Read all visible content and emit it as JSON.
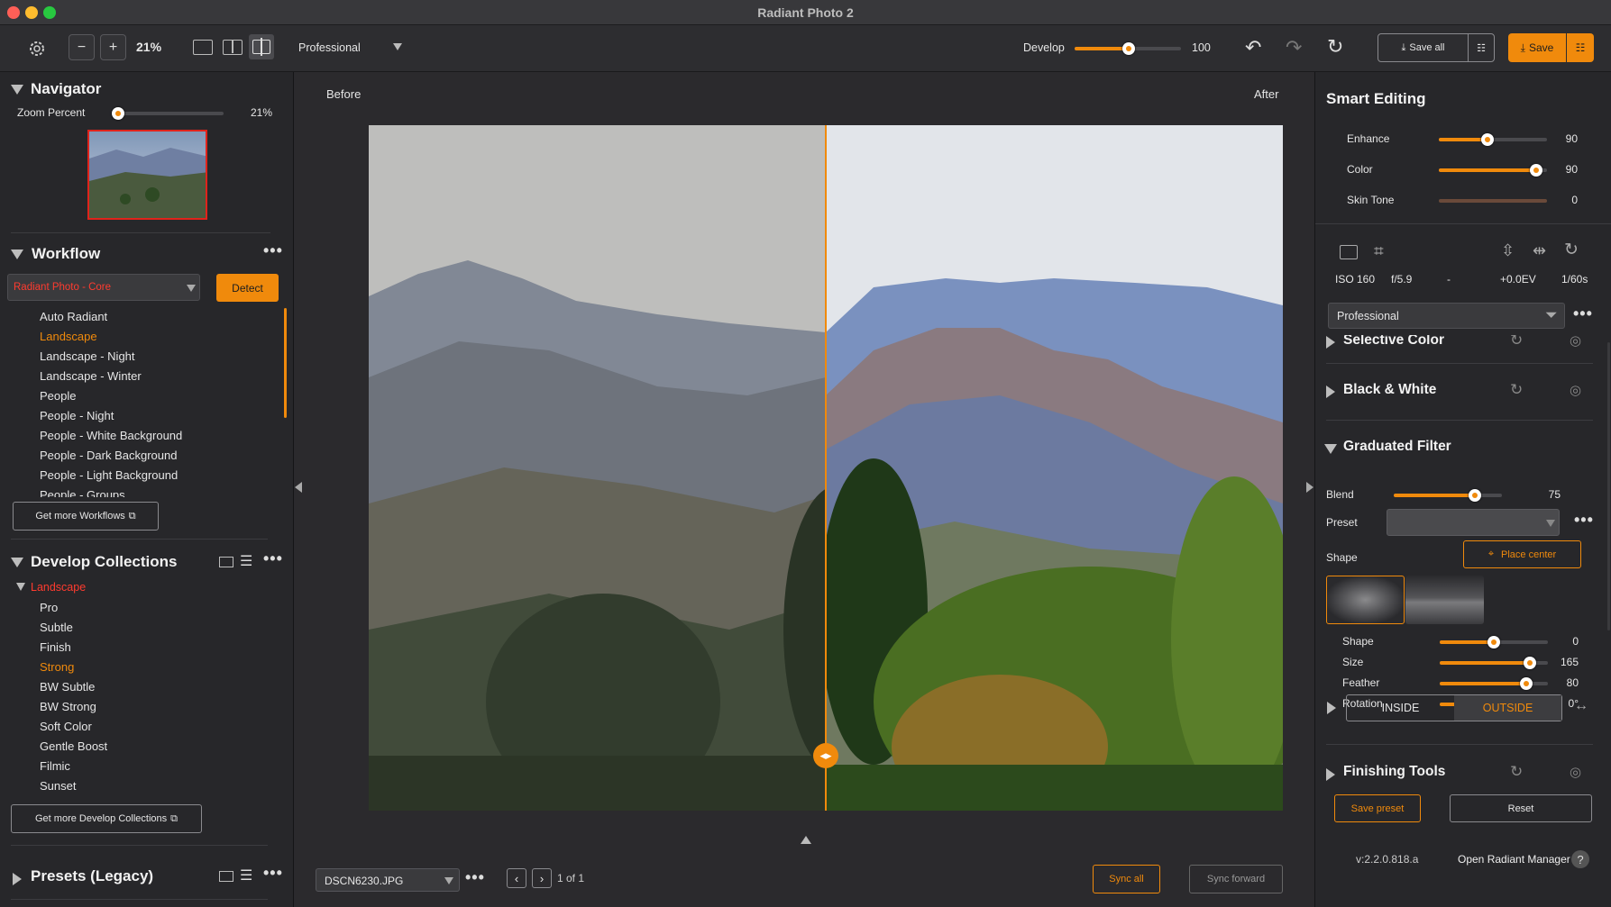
{
  "window": {
    "title": "Radiant Photo 2"
  },
  "toolbar": {
    "zoom": "21%",
    "profile": "Professional",
    "develop_label": "Develop",
    "develop_value": "100",
    "develop_fraction": 1.0,
    "save_all_label": "Save all",
    "save_label": "Save"
  },
  "navigator": {
    "title": "Navigator",
    "zoom_label": "Zoom Percent",
    "zoom_value": "21%",
    "zoom_fraction": 0.0
  },
  "workflow": {
    "title": "Workflow",
    "selected": "Radiant Photo - Core",
    "detect_label": "Detect",
    "items": [
      "Auto Radiant",
      "Landscape",
      "Landscape - Night",
      "Landscape - Winter",
      "People",
      "People - Night",
      "People - White Background",
      "People - Dark Background",
      "People - Light Background",
      "People - Groups"
    ],
    "active_item": "Landscape",
    "more_label": "Get more Workflows"
  },
  "collections": {
    "title": "Develop Collections",
    "group": "Landscape",
    "items": [
      "Pro",
      "Subtle",
      "Finish",
      "Strong",
      "BW Subtle",
      "BW Strong",
      "Soft Color",
      "Gentle Boost",
      "Filmic",
      "Sunset"
    ],
    "active_item": "Strong",
    "more_label": "Get more Develop Collections"
  },
  "presets": {
    "title": "Presets (Legacy)"
  },
  "viewer": {
    "before_label": "Before",
    "after_label": "After",
    "filename": "DSCN6230.JPG",
    "page_count": "1 of 1",
    "sync_all_label": "Sync all",
    "sync_forward_label": "Sync forward"
  },
  "smart": {
    "title": "Smart Editing",
    "sliders": [
      {
        "label": "Enhance",
        "value": "90",
        "fraction": 0.45
      },
      {
        "label": "Color",
        "value": "90",
        "fraction": 0.9
      },
      {
        "label": "Skin Tone",
        "value": "0",
        "fraction": 0.0
      }
    ]
  },
  "exif": {
    "iso": "ISO 160",
    "aperture": "f/5.9",
    "focal": "-",
    "ev": "+0.0EV",
    "shutter": "1/60s"
  },
  "profile_select": "Professional",
  "panels": {
    "selective_color": "Selective Color",
    "black_white": "Black & White",
    "graduated_filter": "Graduated Filter",
    "finishing_tools": "Finishing Tools"
  },
  "grad": {
    "blend_label": "Blend",
    "blend_value": "75",
    "blend_fraction": 0.75,
    "preset_label": "Preset",
    "shape_label": "Shape",
    "place_center_label": "Place center",
    "sliders": [
      {
        "label": "Shape",
        "value": "0",
        "fraction": 0.5
      },
      {
        "label": "Size",
        "value": "165",
        "fraction": 0.83
      },
      {
        "label": "Feather",
        "value": "80",
        "fraction": 0.8
      },
      {
        "label": "Rotation",
        "value": "0°",
        "fraction": 0.5
      }
    ],
    "inside_label": "INSIDE",
    "outside_label": "OUTSIDE"
  },
  "footer": {
    "save_preset_label": "Save preset",
    "reset_label": "Reset",
    "version": "v:2.2.0.818.a",
    "manager_label": "Open Radiant Manager"
  },
  "colors": {
    "accent": "#f08a0c",
    "red": "#ff3b2f"
  }
}
